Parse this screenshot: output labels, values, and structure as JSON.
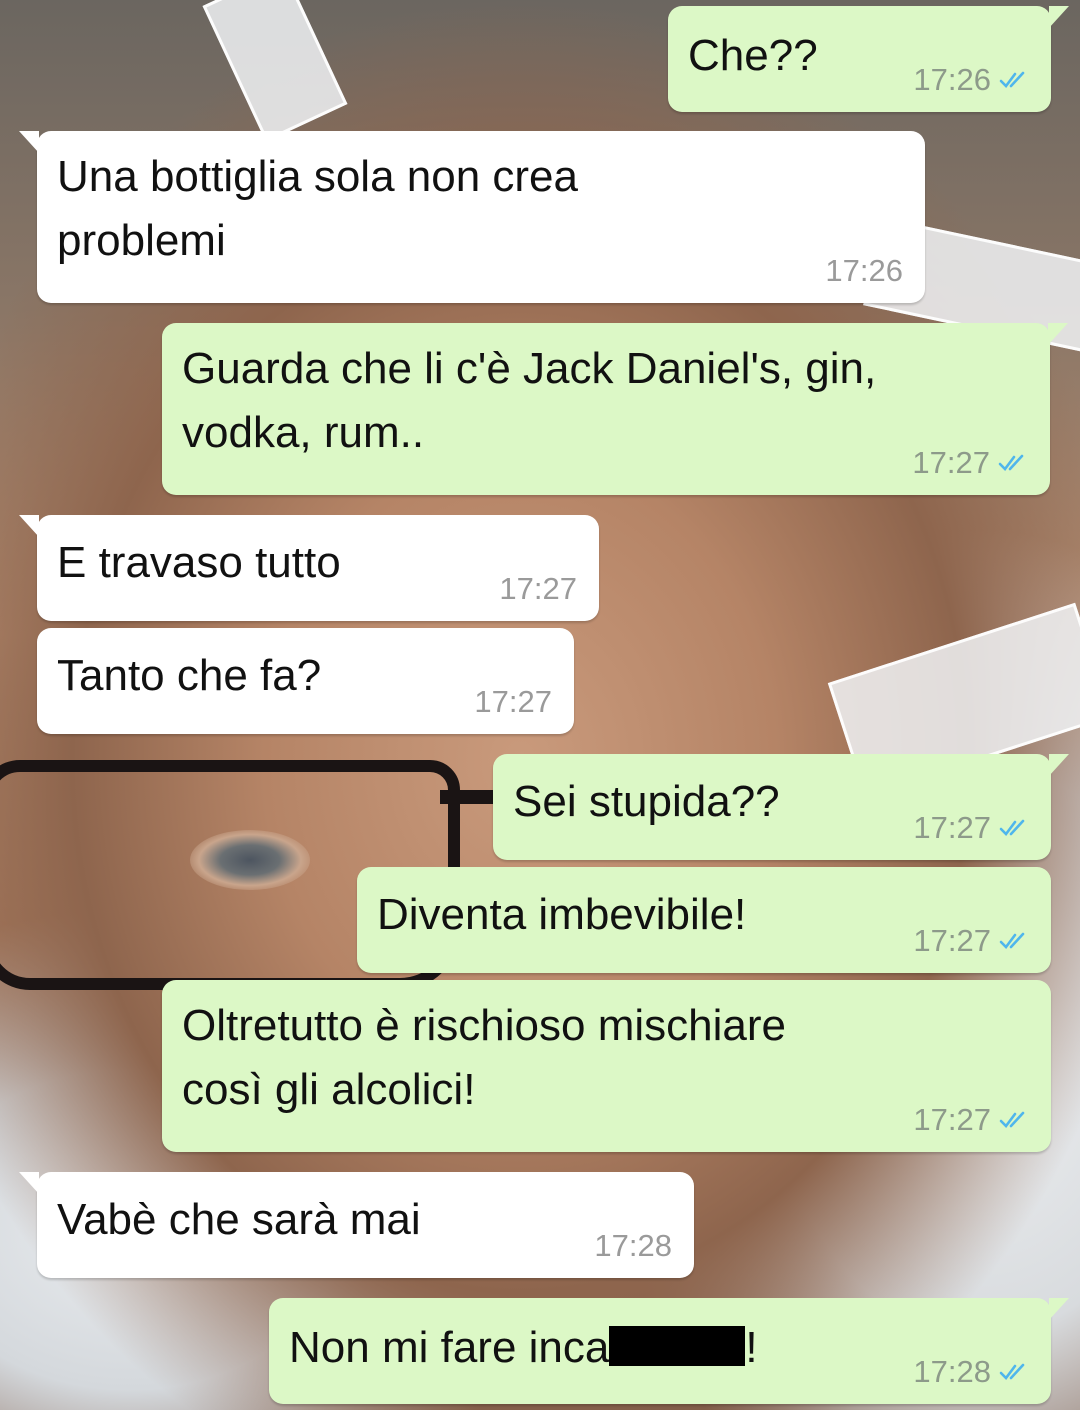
{
  "chat": {
    "messages": [
      {
        "id": "m1",
        "direction": "out",
        "text": "Che??",
        "time": "17:26",
        "status": "read"
      },
      {
        "id": "m2",
        "direction": "in",
        "text_lines": [
          "Una bottiglia sola non crea",
          "problemi"
        ],
        "time": "17:26"
      },
      {
        "id": "m3",
        "direction": "out",
        "text_lines": [
          "Guarda che li c'è Jack Daniel's, gin,",
          "vodka, rum.."
        ],
        "time": "17:27",
        "status": "read"
      },
      {
        "id": "m4",
        "direction": "in",
        "text": "E travaso tutto",
        "time": "17:27"
      },
      {
        "id": "m5",
        "direction": "in",
        "text": "Tanto che fa?",
        "time": "17:27"
      },
      {
        "id": "m6",
        "direction": "out",
        "text": "Sei stupida??",
        "time": "17:27",
        "status": "read"
      },
      {
        "id": "m7",
        "direction": "out",
        "text": "Diventa imbevibile!",
        "time": "17:27",
        "status": "read"
      },
      {
        "id": "m8",
        "direction": "out",
        "text_lines": [
          "Oltretutto è rischioso mischiare",
          "così gli alcolici!"
        ],
        "time": "17:27",
        "status": "read"
      },
      {
        "id": "m9",
        "direction": "in",
        "text": "Vabè che sarà mai",
        "time": "17:28"
      },
      {
        "id": "m10",
        "direction": "out",
        "text_prefix": "Non mi fare inca",
        "text_suffix": "!",
        "redacted": true,
        "time": "17:28",
        "status": "read"
      }
    ]
  },
  "colors": {
    "outgoing_bubble": "#dcf8c6",
    "incoming_bubble": "#ffffff",
    "read_ticks": "#4fb6ec"
  },
  "icons": {
    "read_receipt": "double-check-icon"
  }
}
